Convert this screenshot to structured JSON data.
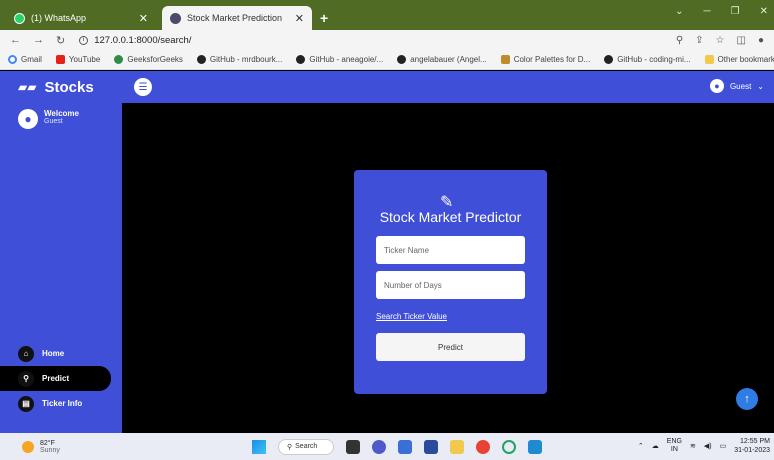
{
  "browser": {
    "tabs": [
      {
        "title": "(1) WhatsApp",
        "active": false
      },
      {
        "title": "Stock Market Prediction",
        "active": true
      }
    ],
    "url": "127.0.0.1:8000/search/",
    "bookmarks": [
      "Gmail",
      "YouTube",
      "GeeksforGeeks",
      "GitHub - mrdbourk...",
      "GitHub - aneagoie/...",
      "angelabauer (Angel...",
      "Color Palettes for D...",
      "GitHub - coding-mi..."
    ],
    "other_bookmarks": "Other bookmarks"
  },
  "app": {
    "brand": "Stocks",
    "header_user": "Guest",
    "sidebar": {
      "welcome_title": "Welcome",
      "welcome_user": "Guest",
      "nav": [
        {
          "label": "Home",
          "icon": "home-icon",
          "active": false
        },
        {
          "label": "Predict",
          "icon": "search-icon",
          "active": true
        },
        {
          "label": "Ticker Info",
          "icon": "info-icon",
          "active": false
        }
      ]
    },
    "card": {
      "title": "Stock Market Predictor",
      "ticker_placeholder": "Ticker Name",
      "days_placeholder": "Number of Days",
      "link_text": "Search Ticker Value",
      "button_label": "Predict"
    },
    "accent_color": "#3f4fd8"
  },
  "taskbar": {
    "weather_temp": "82°F",
    "weather_desc": "Sunny",
    "search_label": "Search",
    "lang_line1": "ENG",
    "lang_line2": "IN",
    "time": "12:55 PM",
    "date": "31-01-2023"
  }
}
